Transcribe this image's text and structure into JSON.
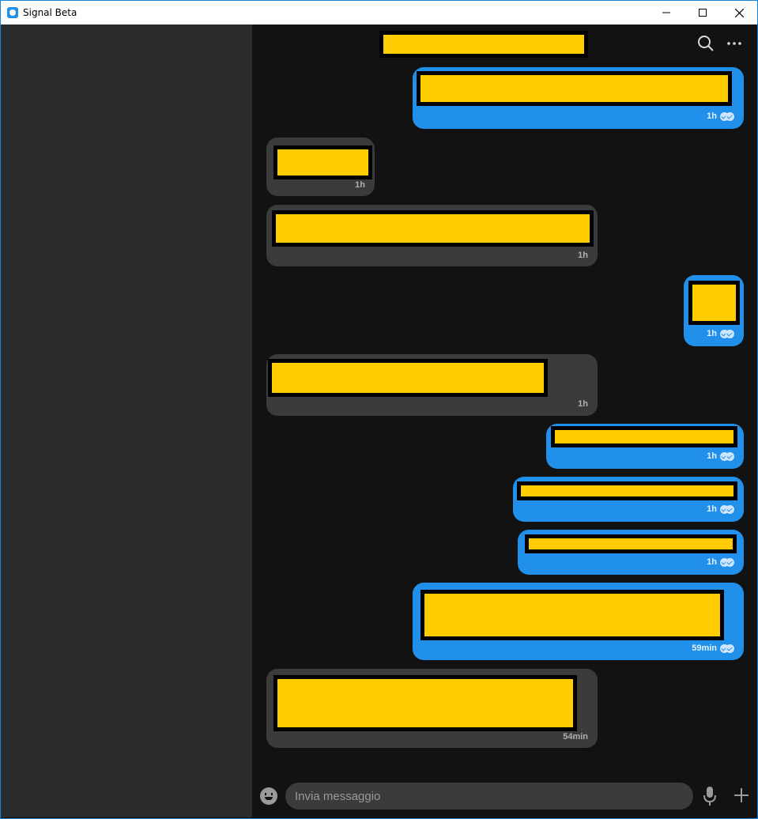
{
  "window": {
    "title": "Signal Beta"
  },
  "composer": {
    "placeholder": "Invia messaggio"
  },
  "messages": [
    {
      "direction": "out",
      "time": "1h"
    },
    {
      "direction": "in",
      "time": "1h"
    },
    {
      "direction": "in",
      "time": "1h"
    },
    {
      "direction": "out",
      "time": "1h"
    },
    {
      "direction": "in",
      "time": "1h"
    },
    {
      "direction": "out",
      "time": "1h"
    },
    {
      "direction": "out",
      "time": "1h"
    },
    {
      "direction": "out",
      "time": "1h"
    },
    {
      "direction": "out",
      "time": "59min"
    },
    {
      "direction": "in",
      "time": "54min"
    }
  ],
  "colors": {
    "outgoing": "#2090ea",
    "incoming": "#3b3b3b",
    "background": "#121212",
    "sidebar": "#2b2b2b",
    "redaction": "#ffcc00"
  },
  "icons": [
    "signal-app-icon",
    "minimize-icon",
    "maximize-icon",
    "close-icon",
    "search-icon",
    "more-icon",
    "emoji-icon",
    "microphone-icon",
    "plus-icon",
    "double-check-icon"
  ]
}
